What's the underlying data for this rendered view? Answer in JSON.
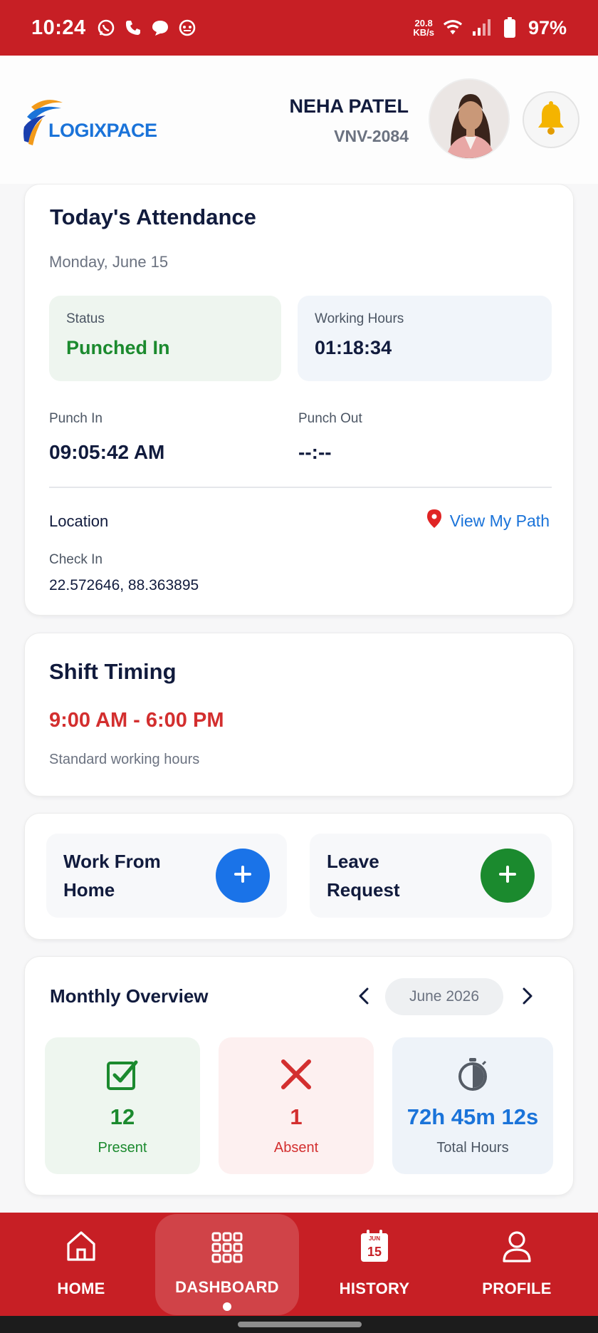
{
  "status_bar": {
    "time": "10:24",
    "net_rate_value": "20.8",
    "net_rate_unit": "KB/s",
    "battery": "97%",
    "left_icons": [
      "whatsapp-icon",
      "phone-icon",
      "message-icon",
      "assistant-icon"
    ],
    "right_icons": [
      "wifi-icon",
      "signal-icon",
      "battery-icon"
    ]
  },
  "header": {
    "logo_text": "LOGIXPACE",
    "user_name": "NEHA PATEL",
    "user_id": "VNV-2084"
  },
  "attendance": {
    "title": "Today's Attendance",
    "date": "Monday, June 15",
    "status_label": "Status",
    "status_value": "Punched In",
    "working_hours_label": "Working Hours",
    "working_hours_value": "01:18:34",
    "punch_in_label": "Punch In",
    "punch_in_value": "09:05:42 AM",
    "punch_out_label": "Punch Out",
    "punch_out_value": "--:--",
    "location_label": "Location",
    "view_path_label": "View My Path",
    "check_in_label": "Check In",
    "check_in_coords": "22.572646, 88.363895"
  },
  "shift": {
    "title": "Shift Timing",
    "time": "9:00 AM - 6:00 PM",
    "subtitle": "Standard working hours"
  },
  "actions": {
    "wfh_line1": "Work From",
    "wfh_line2": "Home",
    "leave_line1": "Leave",
    "leave_line2": "Request"
  },
  "monthly": {
    "title": "Monthly Overview",
    "month": "June 2026",
    "present_value": "12",
    "present_label": "Present",
    "absent_value": "1",
    "absent_label": "Absent",
    "total_value": "72h 45m 12s",
    "total_label": "Total Hours"
  },
  "nav": {
    "home": "HOME",
    "dashboard": "DASHBOARD",
    "history": "HISTORY",
    "history_icon_month": "JUN",
    "history_icon_day": "15",
    "profile": "PROFILE"
  },
  "colors": {
    "brand_red": "#c71f25",
    "accent_blue": "#1a73d9",
    "success_green": "#1b8a2e",
    "danger_red": "#d32f2f"
  }
}
